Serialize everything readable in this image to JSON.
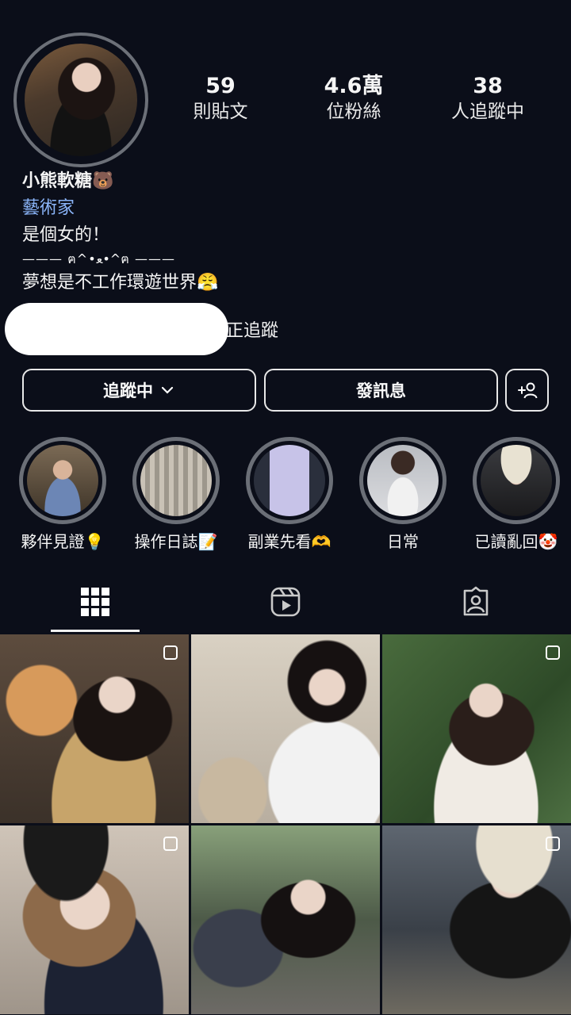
{
  "profile": {
    "stats": [
      {
        "value": "59",
        "label": "則貼文"
      },
      {
        "value": "4.6萬",
        "label": "位粉絲"
      },
      {
        "value": "38",
        "label": "人追蹤中"
      }
    ],
    "name": "小熊軟糖🐻",
    "category": "藝術家",
    "bio": [
      "是個女的！",
      "——— ฅ^•ﻌ•^ฅ ———",
      "夢想是不工作環遊世界😤"
    ],
    "followed_by": "正追蹤"
  },
  "actions": {
    "following_label": "追蹤中",
    "message_label": "發訊息"
  },
  "highlights": [
    {
      "label": "夥伴見證💡"
    },
    {
      "label": "操作日誌📝"
    },
    {
      "label": "副業先看🫶"
    },
    {
      "label": "日常"
    },
    {
      "label": "已讀亂回🤡"
    }
  ],
  "tabs": [
    "posts-grid",
    "reels",
    "tagged"
  ],
  "colors": {
    "background": "#0b0e19",
    "link": "#8ab4f8",
    "ring": "#6b6f77"
  }
}
